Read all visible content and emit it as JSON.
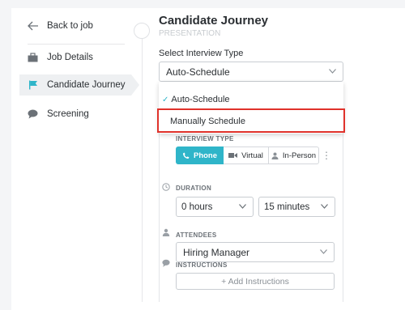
{
  "sidebar": {
    "back_label": "Back to job",
    "items": [
      {
        "label": "Job Details",
        "icon": "briefcase-icon"
      },
      {
        "label": "Candidate Journey",
        "icon": "flag-icon",
        "active": true
      },
      {
        "label": "Screening",
        "icon": "chat-bubble-icon"
      }
    ]
  },
  "main": {
    "title": "Candidate Journey",
    "ghost_text": "PRESENTATION",
    "select_label": "Select Interview Type",
    "select_value": "Auto-Schedule",
    "dropdown_options": [
      "Auto-Schedule",
      "Manually Schedule"
    ],
    "interview_type_label": "INTERVIEW TYPE",
    "interview_types": [
      "Phone",
      "Virtual",
      "In-Person"
    ],
    "duration_label": "DURATION",
    "duration_hours": "0 hours",
    "duration_minutes": "15 minutes",
    "attendees_label": "ATTENDEES",
    "attendee_value": "Hiring Manager",
    "instructions_label": "INSTRUCTIONS",
    "add_instructions": "+ Add Instructions"
  },
  "colors": {
    "accent": "#2fb5c9",
    "highlight": "#e0322b"
  }
}
